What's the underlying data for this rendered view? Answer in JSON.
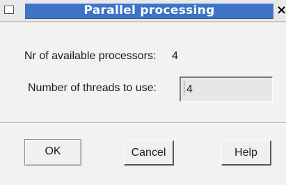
{
  "window": {
    "title": "Parallel processing",
    "title_bar_color": "#3e73c6",
    "close_glyph": "×",
    "menu_icon": "window-menu-icon",
    "close_icon": "close-icon"
  },
  "form": {
    "processors_label": "Nr of available processors:",
    "processors_value": "4",
    "threads_label": "Number of threads to use:",
    "threads_value": "4"
  },
  "buttons": {
    "ok_label": "OK",
    "cancel_label": "Cancel",
    "help_label": "Help"
  }
}
